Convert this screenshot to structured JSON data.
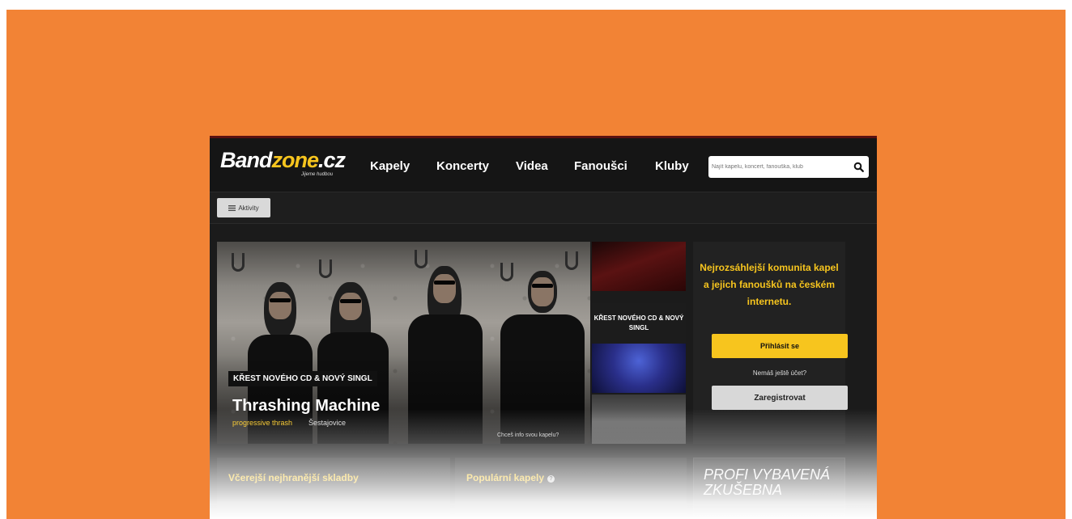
{
  "site": {
    "logo": {
      "main_a": "Band",
      "main_b": "zone",
      "main_c": ".cz",
      "tagline": "Jijeme hudbou"
    },
    "nav": [
      {
        "label": "Kapely"
      },
      {
        "label": "Koncerty"
      },
      {
        "label": "Videa"
      },
      {
        "label": "Fanoušci"
      },
      {
        "label": "Kluby"
      }
    ],
    "search": {
      "placeholder": "Najít kapelu, koncert, fanouška, klub"
    },
    "activity_button": "Aktivity"
  },
  "hero": {
    "label": "KŘEST NOVÉHO CD & NOVÝ SINGL",
    "title": "Thrashing Machine",
    "genre": "progressive thrash",
    "town": "Šestajovice",
    "cta": "Chceš info svou kapelu?"
  },
  "side_thumbs": {
    "label": "KŘEST NOVÉHO CD & NOVÝ SINGL"
  },
  "sidebar": {
    "message": "Nejrozsáhlejší komunita kapel a jejich fanoušků na českém internetu.",
    "login_button": "Přihlásit se",
    "no_account": "Nemáš ještě účet?",
    "register_button": "Zaregistrovat"
  },
  "panels": {
    "yesterday_title": "Včerejší nejhranější skladby",
    "popular_title": "Populární kapely",
    "promo_text": "PROFI VYBAVENÁ ZKUŠEBNA"
  },
  "colors": {
    "background": "#f28335",
    "accent": "#f7c51e",
    "header": "#151515"
  }
}
